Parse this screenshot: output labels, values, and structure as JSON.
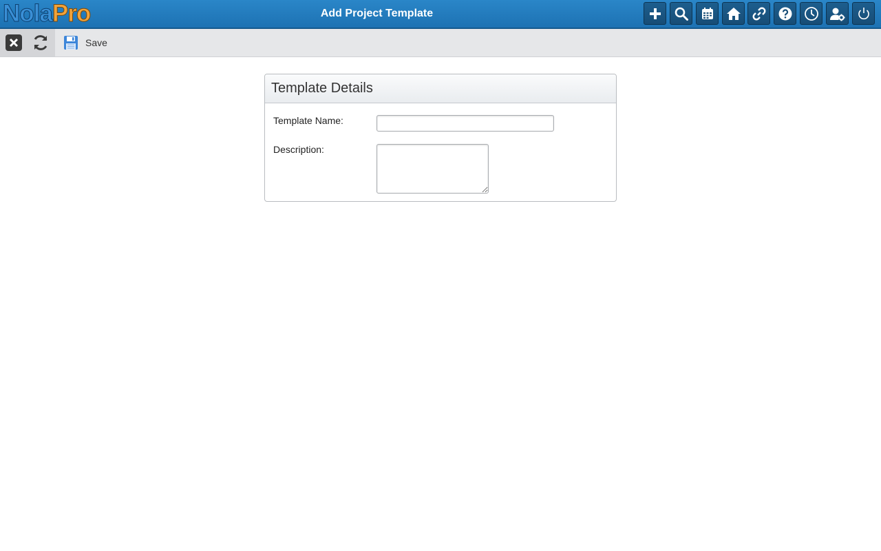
{
  "app": {
    "logo_part1": "Nola",
    "logo_part2": "Pro",
    "page_title": "Add Project Template"
  },
  "header_icons": [
    {
      "name": "add-icon"
    },
    {
      "name": "search-icon"
    },
    {
      "name": "calendar-icon"
    },
    {
      "name": "home-icon"
    },
    {
      "name": "link-icon"
    },
    {
      "name": "help-icon"
    },
    {
      "name": "clock-icon"
    },
    {
      "name": "user-settings-icon"
    },
    {
      "name": "power-icon"
    }
  ],
  "toolbar": {
    "save_label": "Save"
  },
  "form": {
    "panel_title": "Template Details",
    "template_name_label": "Template Name:",
    "template_name_value": "",
    "description_label": "Description:",
    "description_value": ""
  },
  "colors": {
    "header_blue": "#1d72b3",
    "toolbar_gray": "#e6e7e9"
  }
}
